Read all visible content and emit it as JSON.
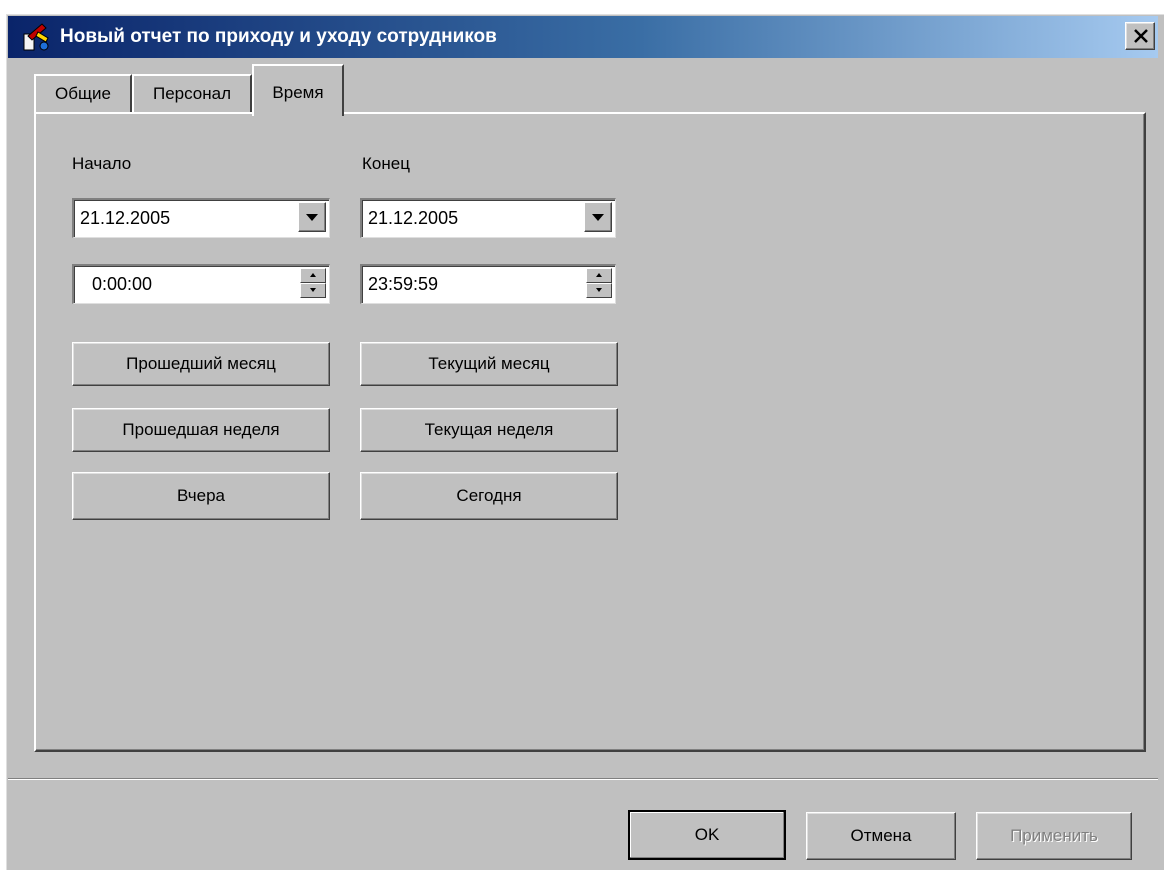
{
  "window": {
    "title": "Новый отчет по приходу и уходу сотрудников",
    "close_symbol": "×",
    "app_icon": "report-icon",
    "colors": {
      "face": "#c0c0c0",
      "titlebar_start": "#0a246a",
      "titlebar_end": "#a6caf0",
      "disabled_text": "#808080"
    }
  },
  "tabs": [
    {
      "label": "Общие",
      "active": false
    },
    {
      "label": "Персонал",
      "active": false
    },
    {
      "label": "Время",
      "active": true
    }
  ],
  "time_tab": {
    "start": {
      "label": "Начало",
      "date": "21.12.2005",
      "time": "0:00:00"
    },
    "end": {
      "label": "Конец",
      "date": "21.12.2005",
      "time": "23:59:59"
    },
    "presets": {
      "prev_month": "Прошедший месяц",
      "cur_month": "Текущий месяц",
      "prev_week": "Прошедшая неделя",
      "cur_week": "Текущая неделя",
      "yesterday": "Вчера",
      "today": "Сегодня"
    }
  },
  "footer": {
    "ok": "OK",
    "cancel": "Отмена",
    "apply": "Применить",
    "apply_enabled": false
  }
}
